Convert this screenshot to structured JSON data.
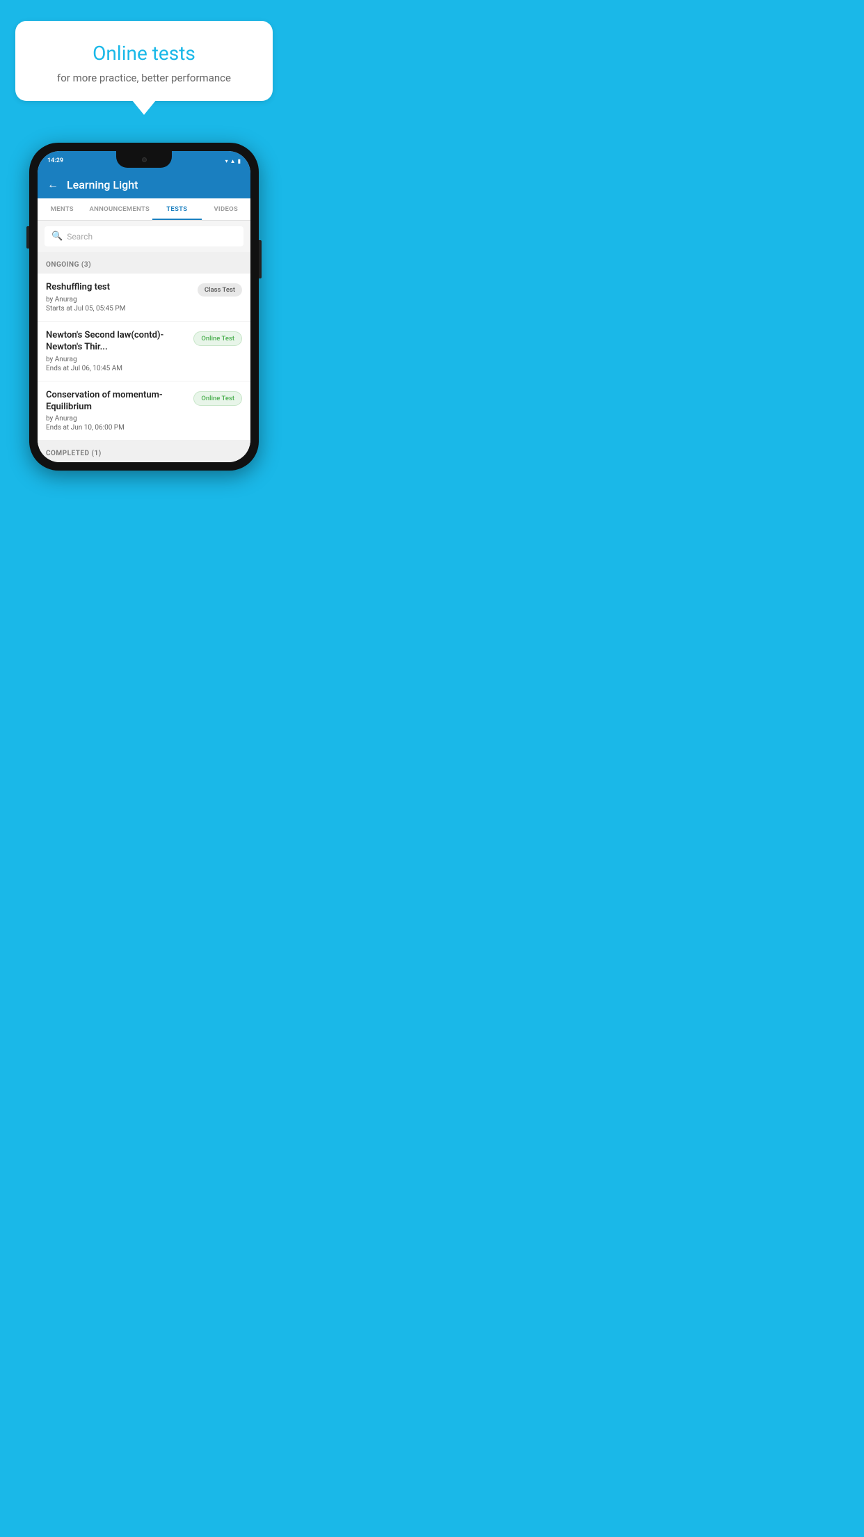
{
  "background_color": "#1ab8e8",
  "bubble": {
    "title": "Online tests",
    "subtitle": "for more practice, better performance"
  },
  "phone": {
    "status_bar": {
      "time": "14:29",
      "icons": [
        "wifi",
        "signal",
        "battery"
      ]
    },
    "header": {
      "title": "Learning Light",
      "back_label": "←"
    },
    "tabs": [
      {
        "label": "MENTS",
        "active": false
      },
      {
        "label": "ANNOUNCEMENTS",
        "active": false
      },
      {
        "label": "TESTS",
        "active": true
      },
      {
        "label": "VIDEOS",
        "active": false
      }
    ],
    "search": {
      "placeholder": "Search"
    },
    "ongoing_section": {
      "title": "ONGOING (3)"
    },
    "tests": [
      {
        "name": "Reshuffling test",
        "author": "by Anurag",
        "time_label": "Starts at",
        "time_value": "Jul 05, 05:45 PM",
        "badge": "Class Test",
        "badge_type": "class"
      },
      {
        "name": "Newton's Second law(contd)-Newton's Thir...",
        "author": "by Anurag",
        "time_label": "Ends at",
        "time_value": "Jul 06, 10:45 AM",
        "badge": "Online Test",
        "badge_type": "online"
      },
      {
        "name": "Conservation of momentum-Equilibrium",
        "author": "by Anurag",
        "time_label": "Ends at",
        "time_value": "Jun 10, 06:00 PM",
        "badge": "Online Test",
        "badge_type": "online"
      }
    ],
    "completed_section": {
      "title": "COMPLETED (1)"
    }
  }
}
